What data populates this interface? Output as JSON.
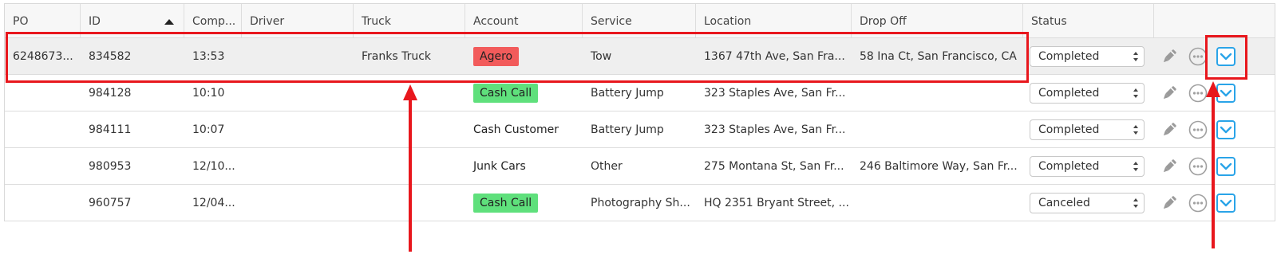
{
  "table": {
    "headers": {
      "po": "PO",
      "id": "ID",
      "completed": "Comp...",
      "driver": "Driver",
      "truck": "Truck",
      "account": "Account",
      "service": "Service",
      "location": "Location",
      "dropoff": "Drop Off",
      "status": "Status"
    },
    "sort": {
      "column": "id",
      "direction": "ascending"
    },
    "rows": [
      {
        "po": "6248673...",
        "id": "834582",
        "completed": "13:53",
        "driver": "",
        "truck": "Franks Truck",
        "account": "Agero",
        "service": "Tow",
        "location": "1367 47th Ave, San Fra...",
        "dropoff": "58 Ina Ct, San Francisco, CA",
        "status": "Completed",
        "selected": true
      },
      {
        "po": "",
        "id": "984128",
        "completed": "10:10",
        "driver": "",
        "truck": "",
        "account": "Cash Call",
        "service": "Battery Jump",
        "location": "323 Staples Ave, San Fr...",
        "dropoff": "",
        "status": "Completed",
        "selected": false
      },
      {
        "po": "",
        "id": "984111",
        "completed": "10:07",
        "driver": "",
        "truck": "",
        "account": "Cash Customer",
        "service": "Battery Jump",
        "location": "323 Staples Ave, San Fr...",
        "dropoff": "",
        "status": "Completed",
        "selected": false
      },
      {
        "po": "",
        "id": "980953",
        "completed": "12/10...",
        "driver": "",
        "truck": "",
        "account": "Junk Cars",
        "service": "Other",
        "location": "275 Montana St, San Fr...",
        "dropoff": "246 Baltimore Way, San Fr...",
        "status": "Completed",
        "selected": false
      },
      {
        "po": "",
        "id": "960757",
        "completed": "12/04...",
        "driver": "",
        "truck": "",
        "account": "Cash Call",
        "service": "Photography Sh...",
        "location": "HQ 2351 Bryant Street, ...",
        "dropoff": "",
        "status": "Canceled",
        "selected": false
      }
    ]
  },
  "account_badge_colors": {
    "Agero": "#f25b5b",
    "Cash Call": "#5fe07c"
  },
  "icons": {
    "edit": "pencil-icon",
    "more": "ellipsis-circle-icon",
    "expand": "chevron-down-icon"
  },
  "colors": {
    "annotation_red": "#e8171d",
    "expand_blue": "#2aa4e8",
    "selected_row_bg": "#efefef"
  }
}
